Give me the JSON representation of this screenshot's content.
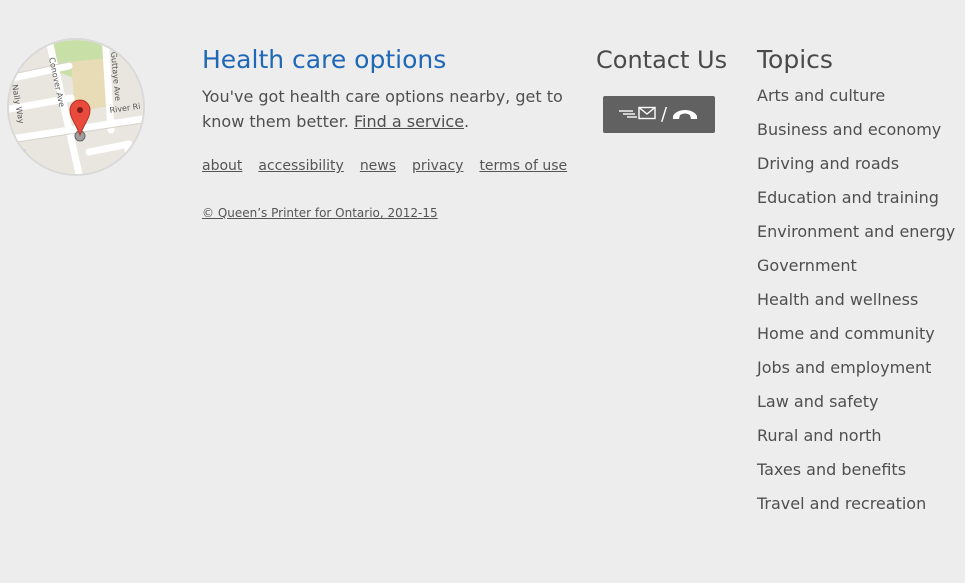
{
  "map": {
    "street_labels": [
      "Conover Ave",
      "Guttaye Ave",
      "River Ri",
      "Nally Way"
    ]
  },
  "health": {
    "title": "Health care options",
    "text_before": "You've got health care options nearby, get to know them better. ",
    "link_text": "Find a service",
    "text_after": "."
  },
  "footer_links": [
    "about",
    "accessibility",
    "news",
    "privacy",
    "terms of use"
  ],
  "copyright": "© Queen’s Printer for Ontario, 2012-15",
  "contact": {
    "title": "Contact Us",
    "button_slash": "/"
  },
  "topics": {
    "title": "Topics",
    "items": [
      "Arts and culture",
      "Business and economy",
      "Driving and roads",
      "Education and training",
      "Environment and energy",
      "Government",
      "Health and wellness",
      "Home and community",
      "Jobs and employment",
      "Law and safety",
      "Rural and north",
      "Taxes and benefits",
      "Travel and recreation"
    ]
  },
  "colors": {
    "background": "#ededed",
    "title_blue": "#1f68b8",
    "button_grey": "#616161",
    "text": "#4a4a4a"
  }
}
